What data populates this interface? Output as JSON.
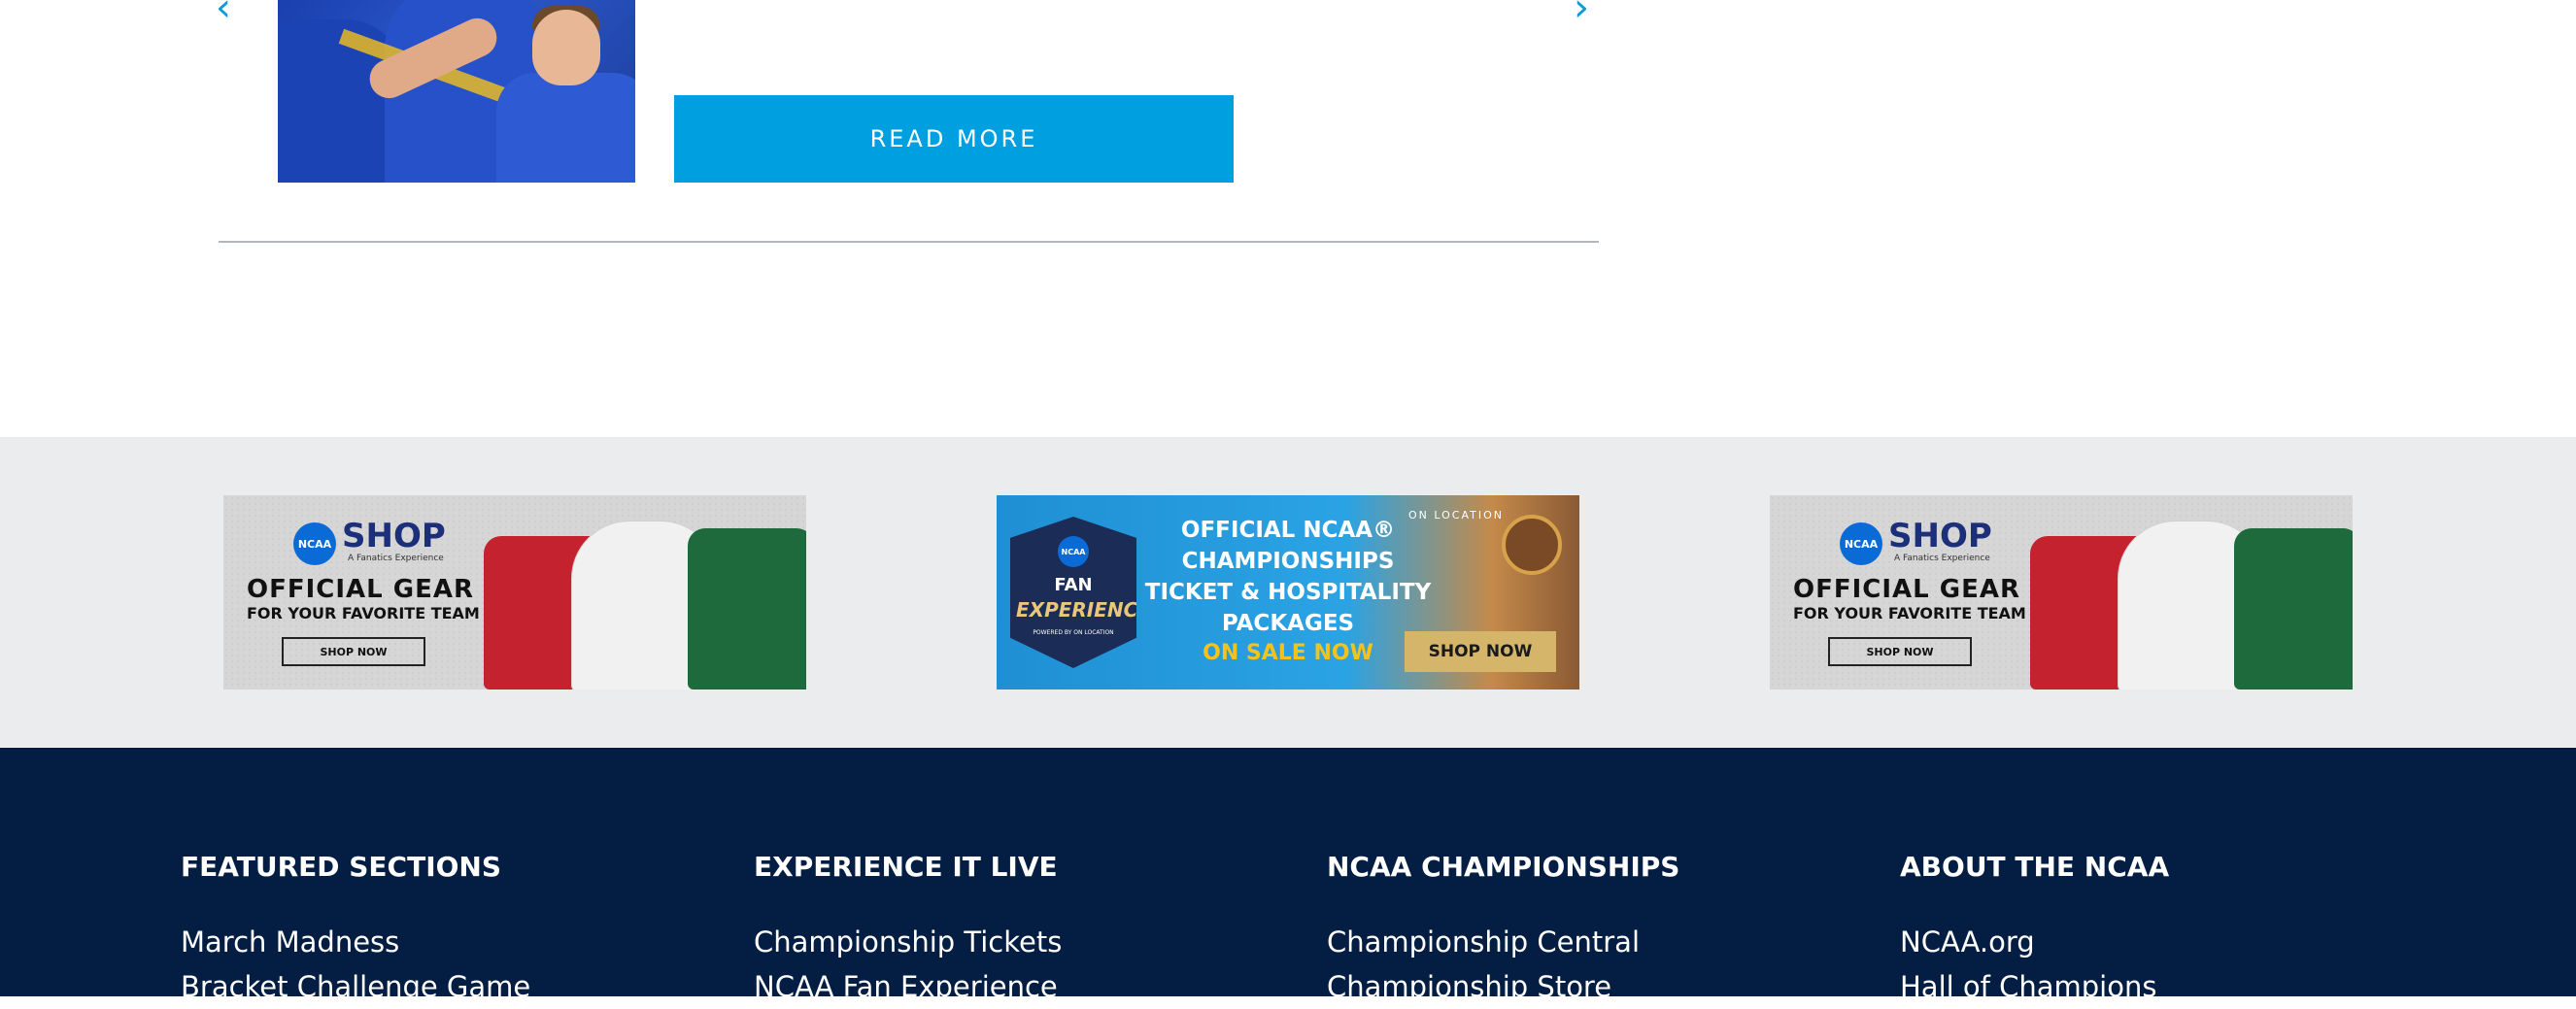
{
  "carousel": {
    "prev_glyph": "‹",
    "next_glyph": "›",
    "read_more_label": "READ MORE"
  },
  "ads": {
    "shop": {
      "logo_text": "NCAA",
      "shop_word": "SHOP",
      "fanatics": "A Fanatics Experience",
      "headline": "OFFICIAL GEAR",
      "subline": "FOR YOUR FAVORITE TEAM",
      "button": "SHOP NOW"
    },
    "fan": {
      "badge_logo": "NCAA",
      "badge_fan": "FAN",
      "badge_experience": "EXPERIENCE",
      "badge_small": "POWERED BY ON LOCATION",
      "headline": "OFFICIAL NCAA® CHAMPIONSHIPS TICKET & HOSPITALITY PACKAGES",
      "on_sale": "ON SALE NOW",
      "on_location": "ON LOCATION",
      "button": "SHOP NOW"
    }
  },
  "footer": {
    "columns": [
      {
        "heading": "FEATURED SECTIONS",
        "links": [
          "March Madness",
          "Bracket Challenge Game"
        ]
      },
      {
        "heading": "EXPERIENCE IT LIVE",
        "links": [
          "Championship Tickets",
          "NCAA Fan Experience"
        ]
      },
      {
        "heading": "NCAA CHAMPIONSHIPS",
        "links": [
          "Championship Central",
          "Championship Store"
        ]
      },
      {
        "heading": "ABOUT THE NCAA",
        "links": [
          "NCAA.org",
          "Hall of Champions"
        ]
      }
    ]
  },
  "colors": {
    "accent": "#009fdf",
    "footer_bg": "#031e42",
    "ad_band_bg": "#ebecee"
  }
}
